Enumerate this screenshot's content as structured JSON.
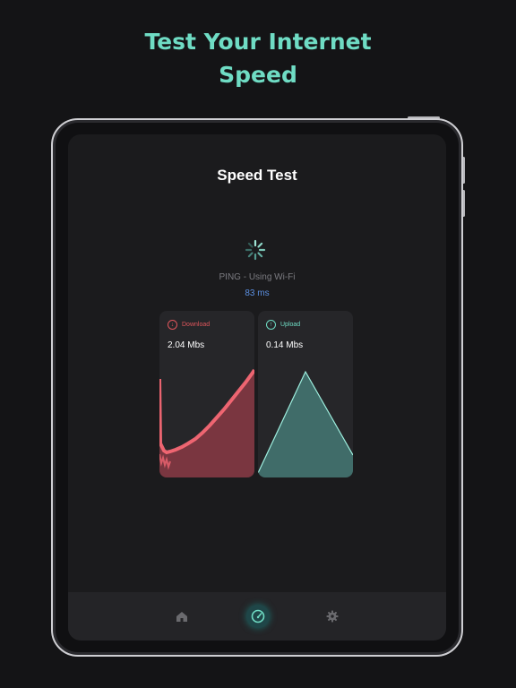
{
  "promo": {
    "line1": "Test Your Internet",
    "line2": "Speed"
  },
  "screen": {
    "title": "Speed Test",
    "ping_label": "PING - Using Wi-Fi",
    "ping_value": "83 ms"
  },
  "download": {
    "label": "Download",
    "value": "2.04 Mbs",
    "color": "#e0565c"
  },
  "upload": {
    "label": "Upload",
    "value": "0.14 Mbs",
    "color": "#6fdcc4"
  },
  "tabs": [
    {
      "icon": "home-icon"
    },
    {
      "icon": "speedometer-icon",
      "active": true
    },
    {
      "icon": "gear-icon"
    }
  ],
  "colors": {
    "accent": "#6fdcc4",
    "background": "#141416",
    "card": "#262629"
  }
}
